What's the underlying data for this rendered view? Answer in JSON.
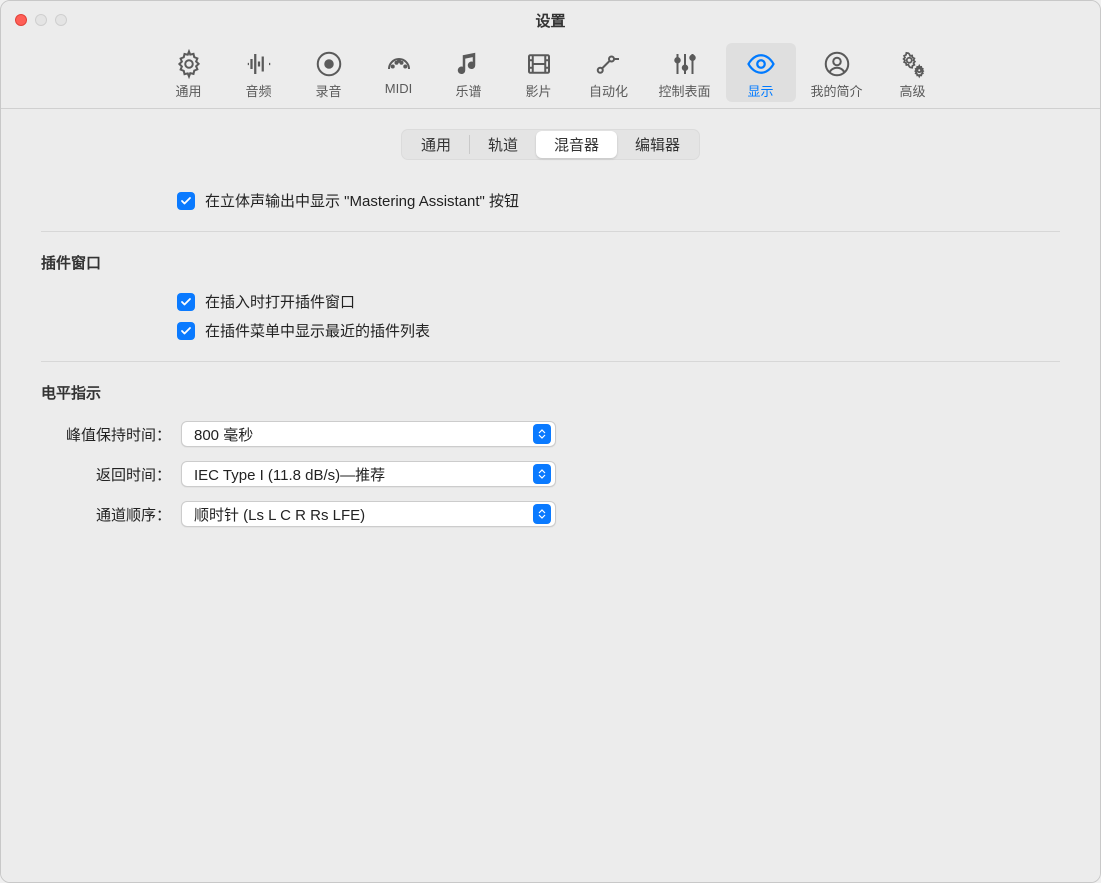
{
  "window": {
    "title": "设置"
  },
  "toolbar": {
    "items": [
      {
        "label": "通用"
      },
      {
        "label": "音频"
      },
      {
        "label": "录音"
      },
      {
        "label": "MIDI"
      },
      {
        "label": "乐谱"
      },
      {
        "label": "影片"
      },
      {
        "label": "自动化"
      },
      {
        "label": "控制表面"
      },
      {
        "label": "显示"
      },
      {
        "label": "我的简介"
      },
      {
        "label": "高级"
      }
    ]
  },
  "segmented": {
    "items": [
      {
        "label": "通用"
      },
      {
        "label": "轨道"
      },
      {
        "label": "混音器"
      },
      {
        "label": "编辑器"
      }
    ]
  },
  "section1": {
    "cb1": "在立体声输出中显示 \"Mastering Assistant\" 按钮"
  },
  "section2": {
    "header": "插件窗口",
    "cb1": "在插入时打开插件窗口",
    "cb2": "在插件菜单中显示最近的插件列表"
  },
  "section3": {
    "header": "电平指示",
    "row1": {
      "label": "峰值保持时间：",
      "value": "800 毫秒"
    },
    "row2": {
      "label": "返回时间：",
      "value": "IEC Type I (11.8 dB/s)—推荐"
    },
    "row3": {
      "label": "通道顺序：",
      "value": "顺时针 (Ls L C R Rs LFE)"
    }
  }
}
